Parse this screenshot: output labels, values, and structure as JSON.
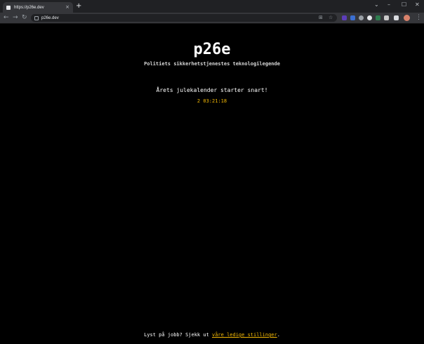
{
  "browser": {
    "tab_title": "https://p26e.dev",
    "tab_close": "×",
    "new_tab": "+",
    "url": "p26e.dev",
    "window_controls": {
      "minimize": "–",
      "maximize": "☐",
      "close": "✕",
      "tabsearch": "⌄"
    },
    "nav": {
      "back": "←",
      "forward": "→",
      "reload": "↻"
    },
    "omnibox_icons": {
      "install": "⊞",
      "bookmark": "☆"
    },
    "menu": "⋮"
  },
  "page": {
    "title": "p26e",
    "subtitle": "Politiets sikkerhetstjenestes teknologilegende",
    "announcement": "Årets julekalender starter snart!",
    "countdown": "2 03:21:18",
    "footer_text": "Lyst på jobb? Sjekk ut ",
    "footer_link": "våre ledige stillinger",
    "footer_end": "."
  },
  "colors": {
    "background": "#000000",
    "accent": "#f2b705",
    "text": "#ffffff"
  }
}
